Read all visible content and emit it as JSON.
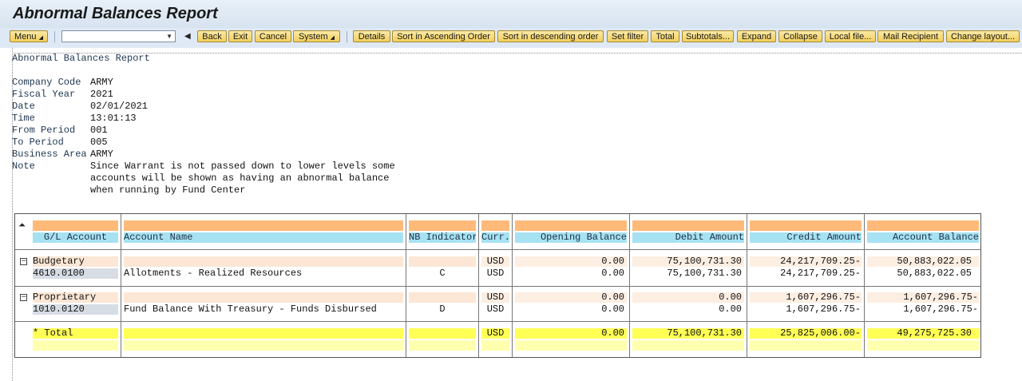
{
  "window": {
    "title": "Abnormal Balances Report"
  },
  "toolbar": {
    "menu": "Menu",
    "back": "Back",
    "exit": "Exit",
    "cancel": "Cancel",
    "system": "System",
    "details": "Details",
    "sort_asc": "Sort in Ascending Order",
    "sort_desc": "Sort in descending order",
    "set_filter": "Set filter",
    "total": "Total",
    "subtotals": "Subtotals...",
    "expand": "Expand",
    "collapse": "Collapse",
    "local_file": "Local file...",
    "mail_recipient": "Mail Recipient",
    "change_layout": "Change layout...",
    "command_field_value": ""
  },
  "report": {
    "heading": "Abnormal Balances Report",
    "params": {
      "company_code_label": "Company Code",
      "company_code": "ARMY",
      "fiscal_year_label": "Fiscal Year",
      "fiscal_year": "2021",
      "date_label": "Date",
      "date": "02/01/2021",
      "time_label": "Time",
      "time": "13:01:13",
      "from_period_label": "From Period",
      "from_period": "001",
      "to_period_label": "To Period",
      "to_period": "005",
      "business_area_label": "Business Area",
      "business_area": "ARMY",
      "note_label": "Note",
      "note_line1": "Since Warrant is not passed down to lower levels some",
      "note_line2": "accounts will be shown as having an abnormal balance",
      "note_line3": "when running by Fund Center"
    },
    "columns": {
      "gl_account": "G/L Account",
      "account_name": "Account Name",
      "nb_indicator": "NB Indicator",
      "currency": "Curr.",
      "opening_balance": "Opening Balance",
      "debit_amount": "Debit Amount",
      "credit_amount": "Credit Amount",
      "account_balance": "Account Balance"
    },
    "groups": [
      {
        "name": "Budgetary",
        "curr": "USD",
        "opening": "0.00",
        "debit": "75,100,731.30",
        "credit": "24,217,709.25-",
        "balance": "50,883,022.05",
        "row": {
          "gl": "4610.0100",
          "name": "Allotments - Realized Resources",
          "nb": "C",
          "curr": "USD",
          "opening": "0.00",
          "debit": "75,100,731.30",
          "credit": "24,217,709.25-",
          "balance": "50,883,022.05"
        }
      },
      {
        "name": "Proprietary",
        "curr": "USD",
        "opening": "0.00",
        "debit": "0.00",
        "credit": "1,607,296.75-",
        "balance": "1,607,296.75-",
        "row": {
          "gl": "1010.0120",
          "name": "Fund Balance With Treasury - Funds Disbursed",
          "nb": "D",
          "curr": "USD",
          "opening": "0.00",
          "debit": "0.00",
          "credit": "1,607,296.75-",
          "balance": "1,607,296.75-"
        }
      }
    ],
    "total": {
      "label": "* Total",
      "curr": "USD",
      "opening": "0.00",
      "debit": "75,100,731.30",
      "credit": "25,825,006.00-",
      "balance": "49,275,725.30"
    }
  }
}
